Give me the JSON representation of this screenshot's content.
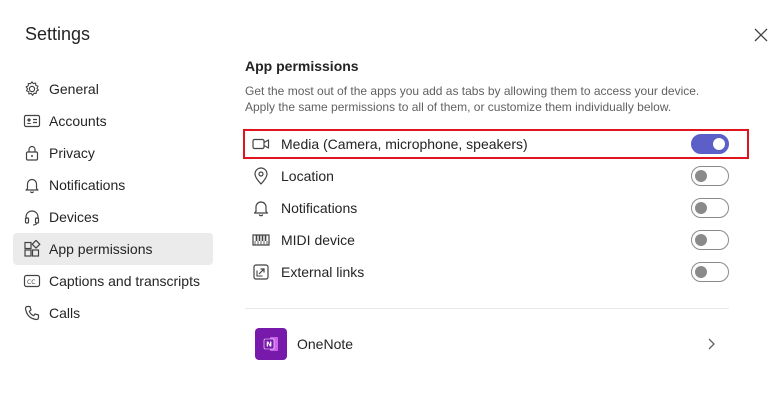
{
  "window": {
    "title": "Settings"
  },
  "sidebar": {
    "items": [
      {
        "label": "General",
        "icon": "gear-icon"
      },
      {
        "label": "Accounts",
        "icon": "id-card-icon"
      },
      {
        "label": "Privacy",
        "icon": "lock-icon"
      },
      {
        "label": "Notifications",
        "icon": "bell-icon"
      },
      {
        "label": "Devices",
        "icon": "headset-icon"
      },
      {
        "label": "App permissions",
        "icon": "apps-icon",
        "active": true
      },
      {
        "label": "Captions and transcripts",
        "icon": "cc-icon"
      },
      {
        "label": "Calls",
        "icon": "phone-icon"
      }
    ]
  },
  "main": {
    "section_title": "App permissions",
    "description": "Get the most out of the apps you add as tabs by allowing them to access your device. Apply the same permissions to all of them, or customize them individually below.",
    "permissions": [
      {
        "label": "Media (Camera, microphone, speakers)",
        "icon": "video-camera-icon",
        "enabled": true,
        "highlighted": true
      },
      {
        "label": "Location",
        "icon": "location-pin-icon",
        "enabled": false
      },
      {
        "label": "Notifications",
        "icon": "bell-icon",
        "enabled": false
      },
      {
        "label": "MIDI device",
        "icon": "keyboard-icon",
        "enabled": false
      },
      {
        "label": "External links",
        "icon": "external-link-icon",
        "enabled": false
      }
    ],
    "apps": [
      {
        "name": "OneNote",
        "icon": "onenote-logo",
        "logo_letter": "N"
      }
    ]
  },
  "colors": {
    "accent": "#5b5fc7",
    "highlight_border": "#e0141e",
    "onenote": "#7719aa",
    "active_nav_bg": "#ebebeb"
  }
}
